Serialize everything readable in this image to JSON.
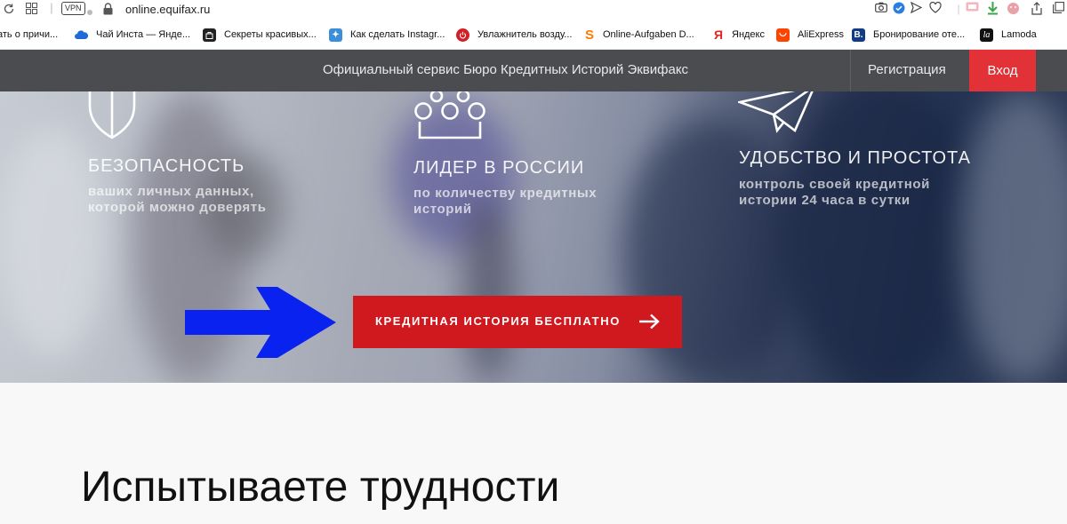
{
  "browser": {
    "url": "online.equifax.ru",
    "vpn_badge": "VPN"
  },
  "bookmarks": [
    {
      "label": "ать о причи...",
      "icon": "",
      "color": "#ffffff"
    },
    {
      "label": "Чай Инста — Янде...",
      "icon": "cloud-icon",
      "color": "#1e6bd8"
    },
    {
      "label": "Секреты красивых...",
      "icon": "bag-icon",
      "color": "#222222"
    },
    {
      "label": "Как сделать Instagr...",
      "icon": "wand-icon",
      "color": "#3b8fd8"
    },
    {
      "label": "Увлажнитель возду...",
      "icon": "power-icon",
      "color": "#d21f26"
    },
    {
      "label": "Online-Aufgaben D...",
      "icon": "s-icon",
      "color": "#ff7a00"
    },
    {
      "label": "Яндекс",
      "icon": "yandex-icon",
      "color": "#e52620"
    },
    {
      "label": "AliExpress",
      "icon": "aliexpress-icon",
      "color": "#ff4400"
    },
    {
      "label": "Бронирование оте...",
      "icon": "booking-icon",
      "color": "#113b85"
    },
    {
      "label": "Lamoda",
      "icon": "lamoda-icon",
      "color": "#111111"
    }
  ],
  "nav": {
    "tagline": "Официальный сервис Бюро Кредитных Историй Эквифакс",
    "register": "Регистрация",
    "login": "Вход"
  },
  "features": [
    {
      "title": "БЕЗОПАСНОСТЬ",
      "sub_1": "ваших личных данных,",
      "sub_2": "которой можно доверять",
      "icon": "shield-icon"
    },
    {
      "title": "ЛИДЕР В РОССИИ",
      "sub_1": "по количеству кредитных",
      "sub_2": "историй",
      "icon": "crown-icon"
    },
    {
      "title": "УДОБСТВО И ПРОСТОТА",
      "sub_1": "контроль своей кредитной",
      "sub_2": "истории 24 часа в сутки",
      "icon": "paper-plane-icon"
    }
  ],
  "cta": {
    "label": "КРЕДИТНАЯ ИСТОРИЯ БЕСПЛАТНО"
  },
  "content": {
    "headline": "Испытываете трудности"
  },
  "colors": {
    "accent_red": "#e23137",
    "cta_red": "#d0181f",
    "nav_bg": "#4b4c4f",
    "annotation_blue": "#0a22f0"
  }
}
